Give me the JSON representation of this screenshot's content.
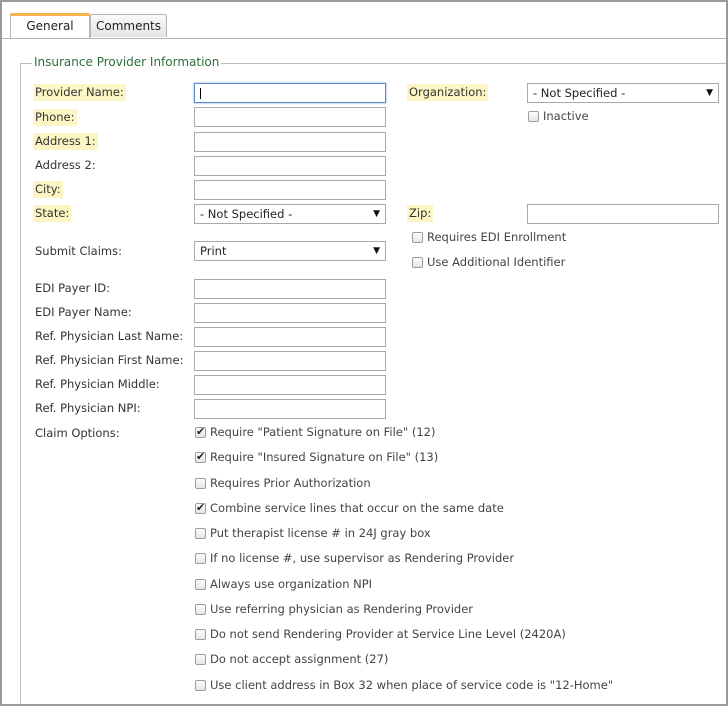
{
  "tabs": [
    {
      "label": "General"
    },
    {
      "label": "Comments"
    }
  ],
  "section_title": "Insurance Provider Information",
  "fields": {
    "provider_name": {
      "label": "Provider Name:",
      "value": ""
    },
    "organization": {
      "label": "Organization:",
      "value": "- Not Specified -"
    },
    "inactive": {
      "label": "Inactive",
      "checked": false
    },
    "phone": {
      "label": "Phone:",
      "value": ""
    },
    "address1": {
      "label": "Address 1:",
      "value": ""
    },
    "address2": {
      "label": "Address 2:",
      "value": ""
    },
    "city": {
      "label": "City:",
      "value": ""
    },
    "state": {
      "label": "State:",
      "value": "- Not Specified -"
    },
    "zip": {
      "label": "Zip:",
      "value": ""
    },
    "submit_claims": {
      "label": "Submit Claims:",
      "value": "Print"
    },
    "requires_edi": {
      "label": "Requires EDI Enrollment",
      "checked": false
    },
    "use_additional_id": {
      "label": "Use Additional Identifier",
      "checked": false
    },
    "edi_payer_id": {
      "label": "EDI Payer ID:",
      "value": ""
    },
    "edi_payer_name": {
      "label": "EDI Payer Name:",
      "value": ""
    },
    "ref_last": {
      "label": "Ref. Physician Last Name:",
      "value": ""
    },
    "ref_first": {
      "label": "Ref. Physician First Name:",
      "value": ""
    },
    "ref_middle": {
      "label": "Ref. Physician Middle:",
      "value": ""
    },
    "ref_npi": {
      "label": "Ref. Physician NPI:",
      "value": ""
    }
  },
  "claim_options": {
    "label": "Claim Options:",
    "items": [
      {
        "label": "Require \"Patient Signature on File\" (12)",
        "checked": true
      },
      {
        "label": "Require \"Insured Signature on File\" (13)",
        "checked": true
      },
      {
        "label": "Requires Prior Authorization",
        "checked": false
      },
      {
        "label": "Combine service lines that occur on the same date",
        "checked": true
      },
      {
        "label": "Put therapist license # in 24J gray box",
        "checked": false
      },
      {
        "label": "If no license #, use supervisor as Rendering Provider",
        "checked": false
      },
      {
        "label": "Always use organization NPI",
        "checked": false
      },
      {
        "label": "Use referring physician as Rendering Provider",
        "checked": false
      },
      {
        "label": "Do not send Rendering Provider at Service Line Level (2420A)",
        "checked": false
      },
      {
        "label": "Do not accept assignment (27)",
        "checked": false
      },
      {
        "label": "Use client address in Box 32 when place of service code is \"12-Home\"",
        "checked": false
      }
    ]
  },
  "checkmark": "✔",
  "dropdown_arrow": "▼"
}
